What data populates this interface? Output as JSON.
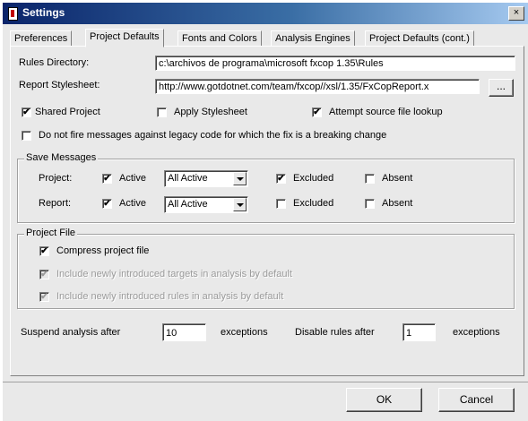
{
  "window": {
    "title": "Settings",
    "close_label": "×"
  },
  "tabs": [
    {
      "label": "Preferences"
    },
    {
      "label": "Project Defaults"
    },
    {
      "label": "Fonts and Colors"
    },
    {
      "label": "Analysis Engines"
    },
    {
      "label": "Project Defaults (cont.)"
    }
  ],
  "active_tab": "Project Defaults",
  "rules_directory": {
    "label": "Rules Directory:",
    "value": "c:\\archivos de programa\\microsoft fxcop 1.35\\Rules"
  },
  "report_stylesheet": {
    "label": "Report Stylesheet:",
    "value": "http://www.gotdotnet.com/team/fxcop//xsl/1.35/FxCopReport.x",
    "browse_label": "..."
  },
  "options": {
    "shared_project": {
      "label": "Shared Project",
      "checked": true
    },
    "apply_stylesheet": {
      "label": "Apply Stylesheet",
      "checked": false
    },
    "attempt_lookup": {
      "label": "Attempt source file lookup",
      "checked": true
    },
    "legacy_code": {
      "label": "Do not fire messages against legacy code for which the fix is a breaking change",
      "checked": false
    }
  },
  "save_messages": {
    "title": "Save Messages",
    "project": {
      "label": "Project:",
      "active_label": "Active",
      "active_checked": true,
      "combo_value": "All Active",
      "excluded_label": "Excluded",
      "excluded_checked": true,
      "absent_label": "Absent",
      "absent_checked": false
    },
    "report": {
      "label": "Report:",
      "active_label": "Active",
      "active_checked": true,
      "combo_value": "All Active",
      "excluded_label": "Excluded",
      "excluded_checked": false,
      "absent_label": "Absent",
      "absent_checked": false
    }
  },
  "project_file": {
    "title": "Project File",
    "compress": {
      "label": "Compress project file",
      "checked": true
    },
    "include_targets": {
      "label": "Include newly introduced targets in analysis by default",
      "checked": true,
      "enabled": false
    },
    "include_rules": {
      "label": "Include newly introduced rules in analysis by default",
      "checked": true,
      "enabled": false
    }
  },
  "limits": {
    "suspend_label": "Suspend analysis after",
    "suspend_value": "10",
    "suspend_suffix": "exceptions",
    "disable_label": "Disable rules after",
    "disable_value": "1",
    "disable_suffix": "exceptions"
  },
  "buttons": {
    "ok": "OK",
    "cancel": "Cancel"
  },
  "check_mark": "✔"
}
